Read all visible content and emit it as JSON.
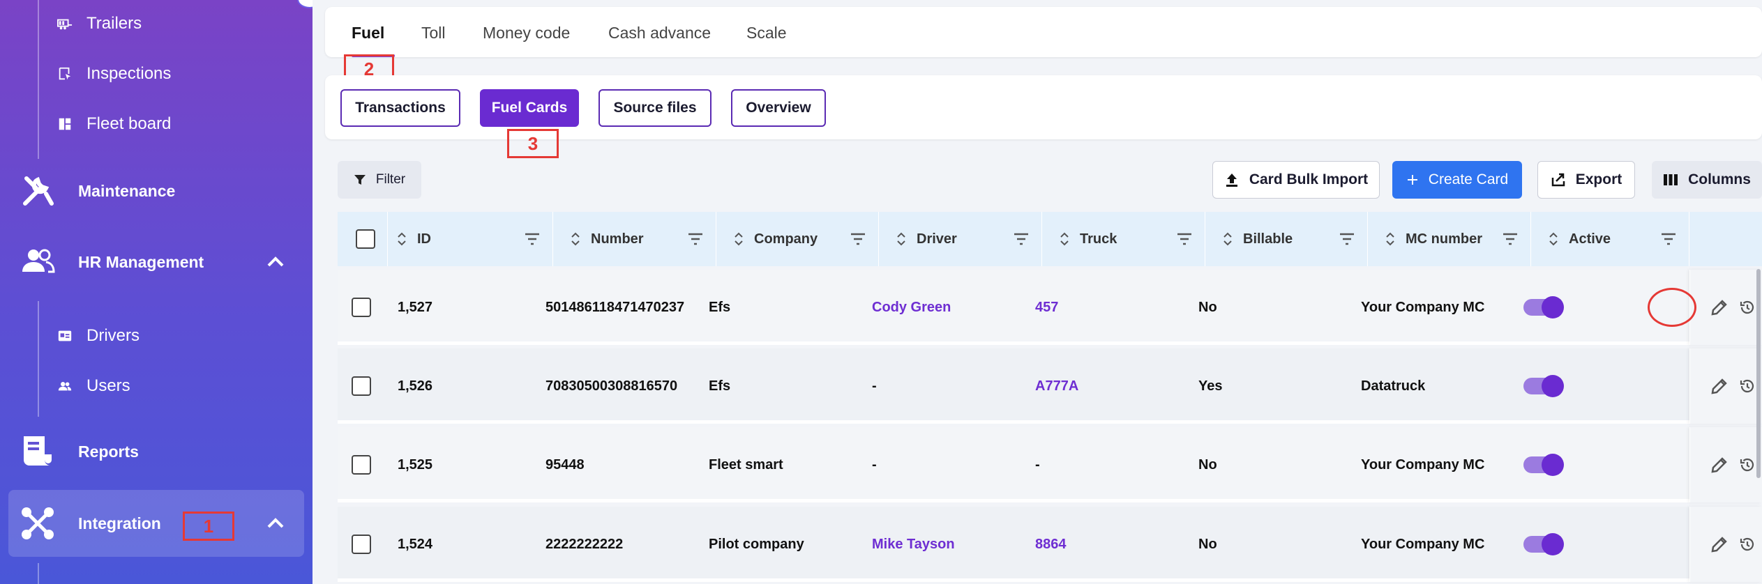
{
  "sidebar": {
    "sub_items_top": [
      {
        "label": "Trailers",
        "icon": "trailer-icon"
      },
      {
        "label": "Inspections",
        "icon": "inspection-icon"
      },
      {
        "label": "Fleet board",
        "icon": "dashboard-icon"
      }
    ],
    "maintenance": {
      "label": "Maintenance",
      "icon": "wrench-icon"
    },
    "hr": {
      "label": "HR Management",
      "icon": "people-icon",
      "expanded": true
    },
    "hr_items": [
      {
        "label": "Drivers",
        "icon": "id-card-icon"
      },
      {
        "label": "Users",
        "icon": "users-icon"
      }
    ],
    "reports": {
      "label": "Reports",
      "icon": "report-icon"
    },
    "integration": {
      "label": "Integration",
      "icon": "integration-icon",
      "expanded": true,
      "active": true
    }
  },
  "tabs": [
    {
      "label": "Fuel",
      "active": true
    },
    {
      "label": "Toll"
    },
    {
      "label": "Money code"
    },
    {
      "label": "Cash advance"
    },
    {
      "label": "Scale"
    }
  ],
  "subtabs": [
    {
      "label": "Transactions"
    },
    {
      "label": "Fuel Cards",
      "active": true
    },
    {
      "label": "Source files"
    },
    {
      "label": "Overview"
    }
  ],
  "annotations": {
    "a1": "1",
    "a2": "2",
    "a3": "3"
  },
  "toolbar": {
    "filter": "Filter",
    "bulk_import": "Card Bulk Import",
    "create": "Create Card",
    "export": "Export",
    "columns": "Columns"
  },
  "table": {
    "columns": [
      "ID",
      "Number",
      "Company",
      "Driver",
      "Truck",
      "Billable",
      "MC number",
      "Active"
    ],
    "rows": [
      {
        "id": "1,527",
        "number": "501486118471470237",
        "company": "Efs",
        "driver": "Cody Green",
        "truck": "457",
        "billable": "No",
        "mc": "Your Company MC",
        "active": true
      },
      {
        "id": "1,526",
        "number": "70830500308816570",
        "company": "Efs",
        "driver": "-",
        "truck": "A777A",
        "billable": "Yes",
        "mc": "Datatruck",
        "active": true
      },
      {
        "id": "1,525",
        "number": "95448",
        "company": "Fleet smart",
        "driver": "-",
        "truck": "-",
        "billable": "No",
        "mc": "Your Company MC",
        "active": true
      },
      {
        "id": "1,524",
        "number": "2222222222",
        "company": "Pilot company",
        "driver": "Mike Tayson",
        "truck": "8864",
        "billable": "No",
        "mc": "Your Company MC",
        "active": true
      }
    ]
  },
  "colors": {
    "accent": "#6a2bd1",
    "primary": "#2f74f0",
    "annotation": "#e53935"
  }
}
